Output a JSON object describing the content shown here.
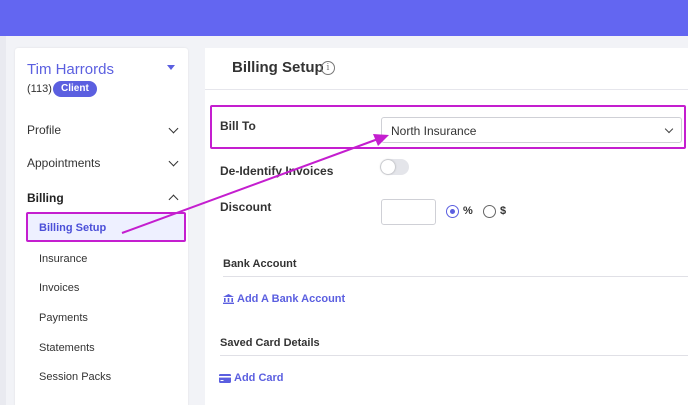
{
  "client": {
    "name": "Tim Harrords",
    "id": "(113)",
    "badge": "Client"
  },
  "sidebar": {
    "items": [
      {
        "label": "Profile"
      },
      {
        "label": "Appointments"
      },
      {
        "label": "Billing"
      }
    ],
    "billing_sub": [
      {
        "label": "Billing Setup"
      },
      {
        "label": "Insurance"
      },
      {
        "label": "Invoices"
      },
      {
        "label": "Payments"
      },
      {
        "label": "Statements"
      },
      {
        "label": "Session Packs"
      }
    ]
  },
  "main": {
    "title": "Billing Setup",
    "info_glyph": "i",
    "bill_to": {
      "label": "Bill To",
      "value": "North Insurance"
    },
    "deidentify": {
      "label": "De-Identify Invoices"
    },
    "discount": {
      "label": "Discount",
      "value": "",
      "options": [
        "%",
        "$"
      ]
    },
    "bank_account": {
      "title": "Bank Account",
      "link": "Add A Bank Account"
    },
    "saved_card": {
      "title": "Saved Card Details",
      "link": "Add Card"
    }
  },
  "colors": {
    "accent": "#6366f1",
    "link": "#5b5fe0",
    "annotation": "#c41ecf"
  },
  "icons": [
    "chevron-down-icon",
    "chevron-up-icon",
    "info-icon",
    "bank-icon",
    "credit-card-icon"
  ]
}
